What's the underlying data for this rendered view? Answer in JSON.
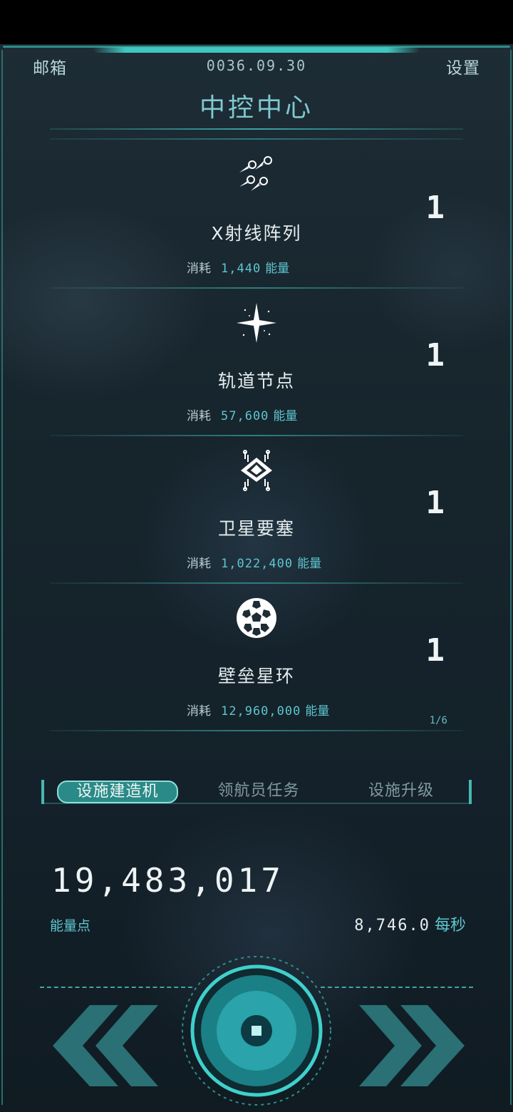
{
  "header": {
    "mailbox_label": "邮箱",
    "date": "0036.09.30",
    "settings_label": "设置",
    "title": "中控中心"
  },
  "facilities": [
    {
      "name": "X射线阵列",
      "cost_label": "消耗",
      "cost_value": "1,440",
      "cost_unit": "能量",
      "count": "1",
      "icon": "xray-array-icon"
    },
    {
      "name": "轨道节点",
      "cost_label": "消耗",
      "cost_value": "57,600",
      "cost_unit": "能量",
      "count": "1",
      "icon": "orbital-node-icon"
    },
    {
      "name": "卫星要塞",
      "cost_label": "消耗",
      "cost_value": "1,022,400",
      "cost_unit": "能量",
      "count": "1",
      "icon": "satellite-fortress-icon"
    },
    {
      "name": "壁垒星环",
      "cost_label": "消耗",
      "cost_value": "12,960,000",
      "cost_unit": "能量",
      "count": "1",
      "sub": "1/6",
      "icon": "bastion-ring-icon"
    }
  ],
  "tabs": [
    {
      "label": "设施建造机",
      "active": true
    },
    {
      "label": "领航员任务",
      "active": false
    },
    {
      "label": "设施升级",
      "active": false
    }
  ],
  "energy": {
    "total": "19,483,017",
    "label": "能量点",
    "rate": "8,746.0",
    "rate_unit": "每秒"
  },
  "colors": {
    "accent": "#5ec6d0",
    "frame": "#3fc7bf",
    "active_tab": "#2a8a87"
  }
}
